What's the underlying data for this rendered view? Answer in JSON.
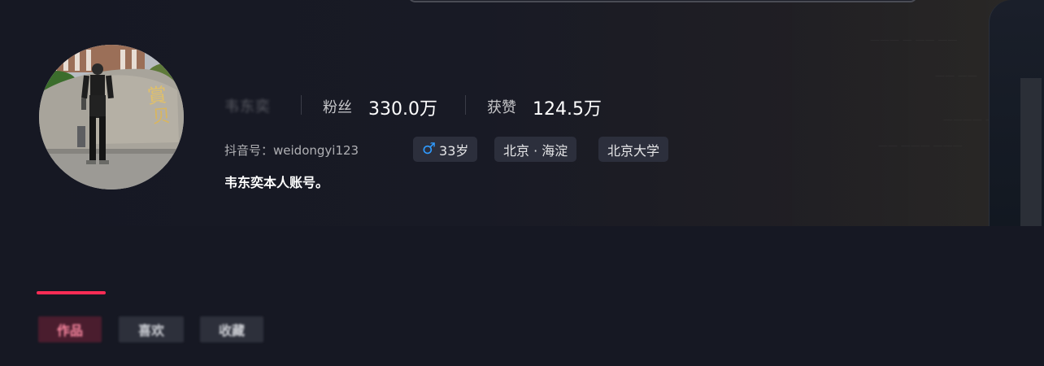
{
  "profile": {
    "nickname": "韦东奕",
    "stats": [
      {
        "label": "粉丝",
        "value": "330.0万"
      },
      {
        "label": "获赞",
        "value": "124.5万"
      }
    ],
    "douyin_id_label": "抖音号：",
    "douyin_id": "weidongyi123",
    "gender": "male",
    "gender_icon": "male-icon",
    "gender_color": "#2f9bff",
    "age": "33岁",
    "location": "北京 · 海淀",
    "school": "北京大学",
    "bio": "韦东奕本人账号。"
  },
  "tabs": [
    {
      "label": "作品",
      "active": true
    },
    {
      "label": "喜欢",
      "active": false
    },
    {
      "label": "收藏",
      "active": false
    }
  ],
  "colors": {
    "background": "#161823",
    "accent": "#fe2c55",
    "tag_bg": "#2c2f3c"
  }
}
